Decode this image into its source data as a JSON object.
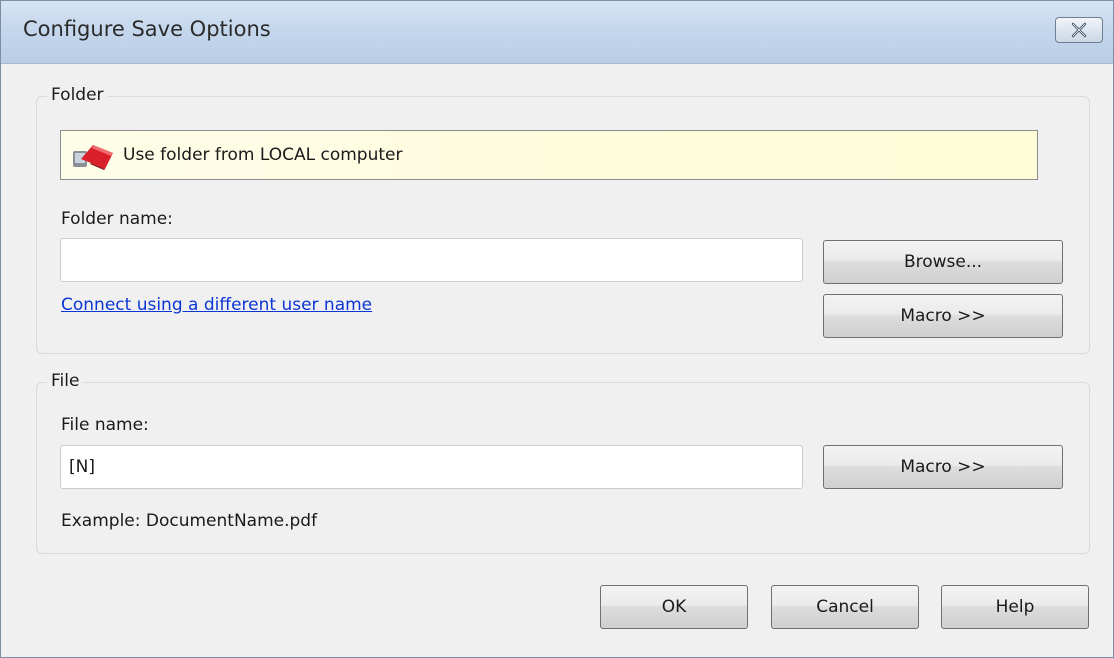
{
  "window": {
    "title": "Configure Save Options",
    "close_icon": "close-icon"
  },
  "folder_group": {
    "legend": "Folder",
    "location": {
      "icon": "local-computer-icon",
      "text": "Use folder from LOCAL computer"
    },
    "folder_name_label": "Folder name:",
    "folder_name_value": "",
    "browse_label": "Browse...",
    "macro_label": "Macro >>",
    "connect_link": "Connect using a different user name"
  },
  "file_group": {
    "legend": "File",
    "file_name_label": "File name:",
    "file_name_value": "[N]",
    "macro_label": "Macro >>",
    "example_text": "Example: DocumentName.pdf"
  },
  "footer": {
    "ok_label": "OK",
    "cancel_label": "Cancel",
    "help_label": "Help"
  }
}
